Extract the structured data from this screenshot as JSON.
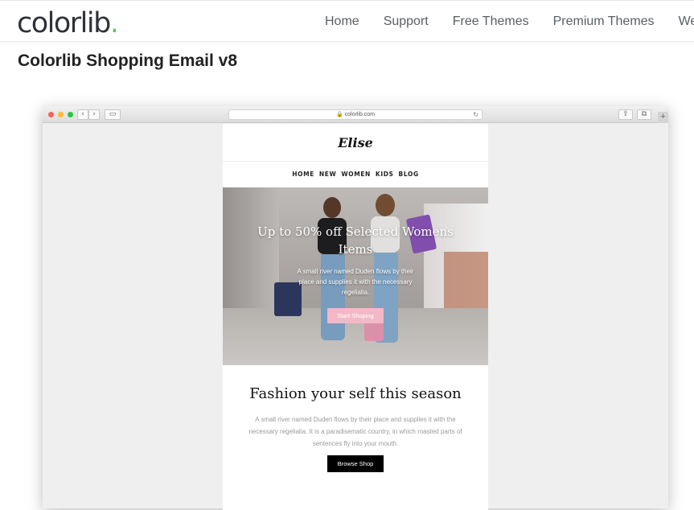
{
  "site": {
    "logo": "colorlib",
    "logo_dot": ".",
    "nav": [
      "Home",
      "Support",
      "Free Themes",
      "Premium Themes",
      "Web"
    ]
  },
  "page_title": "Colorlib Shopping Email v8",
  "browser": {
    "url": "colorlib.com"
  },
  "email": {
    "brand": "Elise",
    "nav": [
      "HOME",
      "NEW",
      "WOMEN",
      "KIDS",
      "BLOG"
    ],
    "hero": {
      "title": "Up to 50% off Selected Womens Items",
      "text": "A small river named Duden flows by their place and supplies it with the necessary regelialia.",
      "button": "Start Shoping"
    },
    "section": {
      "title": "Fashion your self this season",
      "text": "A small river named Duden flows by their place and supplies it with the necessary regelialia. It is a paradisematic country, in which roasted parts of sentences fly into your mouth.",
      "button": "Browse Shop"
    }
  },
  "colors": {
    "logo_accent": "#64c466",
    "hero_button": "#f3b8c8",
    "browse_button": "#000000"
  }
}
